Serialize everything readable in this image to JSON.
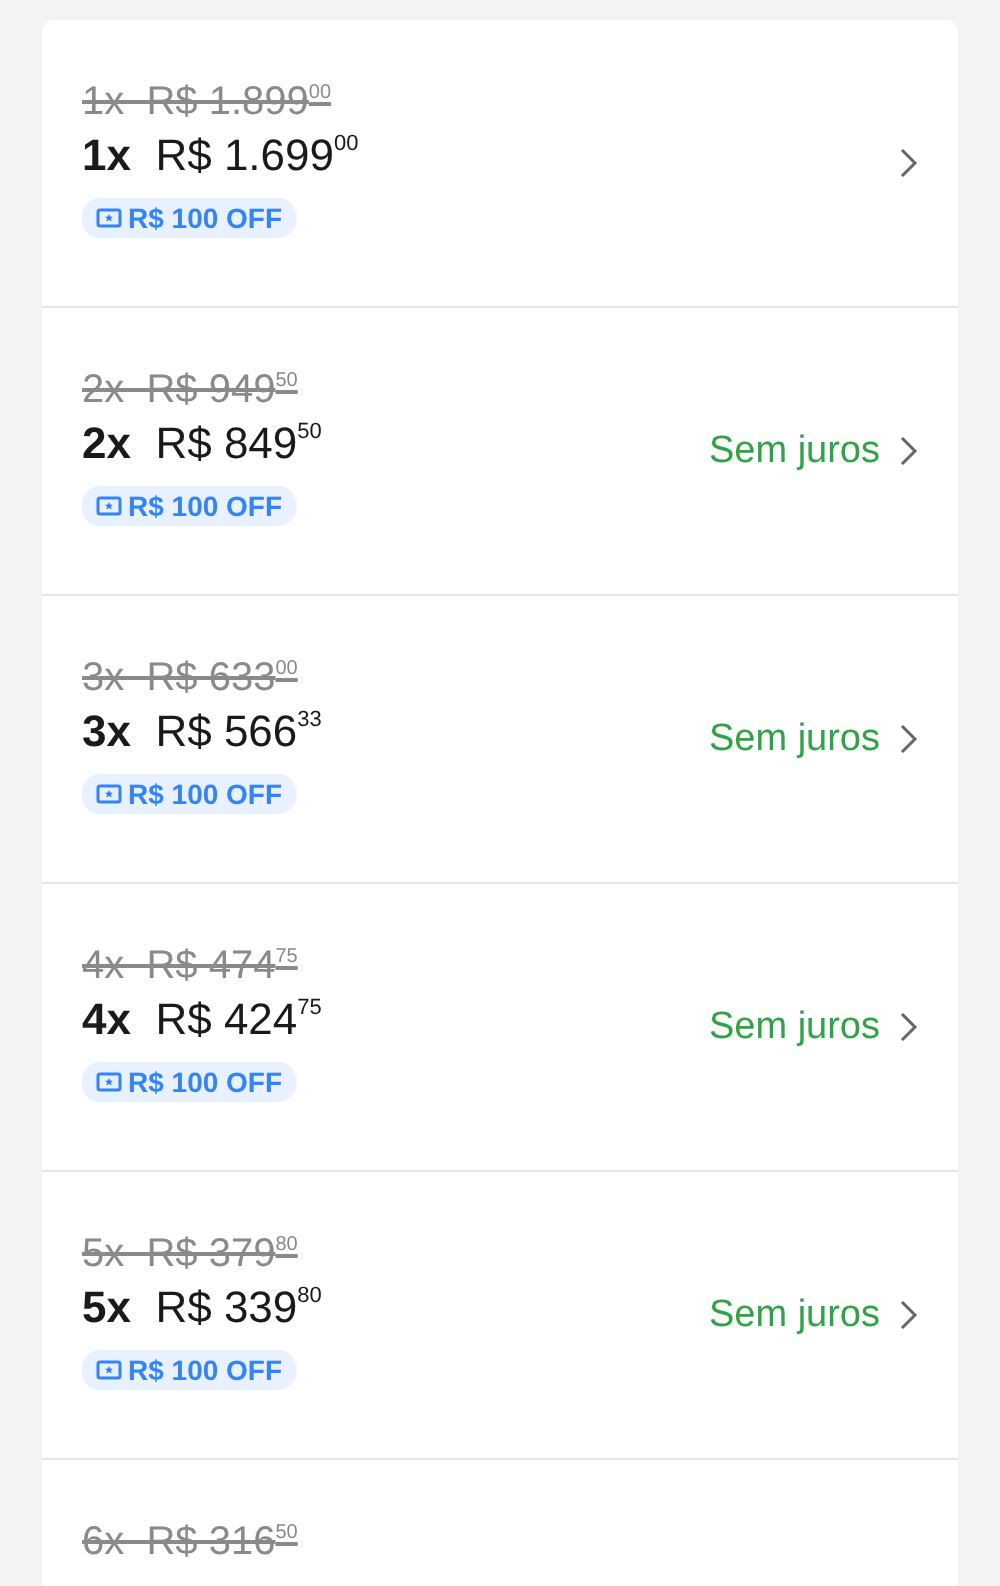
{
  "installments": [
    {
      "old_price": "1x  R$ 1.899$^{00}$",
      "price": "**1x**  R$ 1.699$^{00}$",
      "discount": "R$ 100 OFF"
    },
    {
      "old_price": "2x  R$ 949$^{50}$",
      "price": "**2x**  R$ 849$^{50}$",
      "discount": "R$ 100 OFF",
      "note": "Sem juros"
    },
    {
      "old_price": "3x  R$ 633$^{00}$",
      "price": "**3x**  R$ 566$^{33}$",
      "discount": "R$ 100 OFF",
      "note": "Sem juros"
    },
    {
      "old_price": "4x  R$ 474$^{75}$",
      "price": "**4x**  R$ 424$^{75}$",
      "discount": "R$ 100 OFF",
      "note": "Sem juros"
    },
    {
      "old_price": "5x  R$ 379$^{80}$",
      "price": "**5x**  R$ 339$^{80}$",
      "discount": "R$ 100 OFF",
      "note": "Sem juros"
    },
    {
      "old_price": "6x  R$ 316$^{50}$"
    }
  ]
}
